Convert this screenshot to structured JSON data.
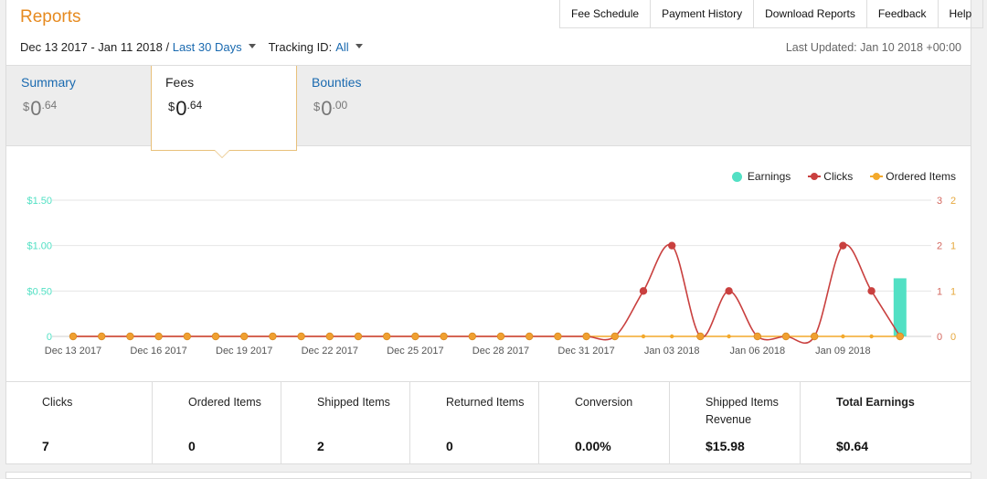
{
  "header": {
    "title": "Reports"
  },
  "nav_links": [
    "Fee Schedule",
    "Payment History",
    "Download Reports",
    "Feedback",
    "Help"
  ],
  "filters": {
    "date_range": "Dec 13 2017 - Jan 11 2018",
    "separator": " / ",
    "preset": "Last 30 Days",
    "tracking_label": "Tracking ID:",
    "tracking_value": "All"
  },
  "last_updated": "Last Updated: Jan 10 2018 +00:00",
  "tabs": [
    {
      "name": "Summary",
      "currency": "$",
      "whole": "0",
      "cents": ".64",
      "active": false
    },
    {
      "name": "Fees",
      "currency": "$",
      "whole": "0",
      "cents": ".64",
      "active": true
    },
    {
      "name": "Bounties",
      "currency": "$",
      "whole": "0",
      "cents": ".00",
      "active": false
    }
  ],
  "legend": {
    "earnings": "Earnings",
    "clicks": "Clicks",
    "ordered": "Ordered Items"
  },
  "colors": {
    "accent": "#e68a1f",
    "link": "#1a6ab0",
    "earnings": "#52e0c4",
    "clicks": "#c9403f",
    "ordered": "#f3a92b",
    "clicks_axis": "#d4685f",
    "ordered_axis": "#e6a83e"
  },
  "chart_data": {
    "type": "line",
    "x_ticks": [
      "Dec 13 2017",
      "Dec 16 2017",
      "Dec 19 2017",
      "Dec 22 2017",
      "Dec 25 2017",
      "Dec 28 2017",
      "Dec 31 2017",
      "Jan 03 2018",
      "Jan 06 2018",
      "Jan 09 2018"
    ],
    "left_axis": {
      "ticks": [
        "0",
        "$0.50",
        "$1.00",
        "$1.50"
      ],
      "range": [
        0,
        1.5
      ]
    },
    "right_axis_clicks": {
      "ticks": [
        "0",
        "1",
        "2",
        "3"
      ],
      "range": [
        0,
        3
      ]
    },
    "right_axis_ordered": {
      "ticks": [
        "0",
        "1",
        "1",
        "2"
      ],
      "range": [
        0,
        2
      ]
    },
    "categories": [
      "Dec 13",
      "Dec 14",
      "Dec 15",
      "Dec 16",
      "Dec 17",
      "Dec 18",
      "Dec 19",
      "Dec 20",
      "Dec 21",
      "Dec 22",
      "Dec 23",
      "Dec 24",
      "Dec 25",
      "Dec 26",
      "Dec 27",
      "Dec 28",
      "Dec 29",
      "Dec 30",
      "Dec 31",
      "Jan 01",
      "Jan 02",
      "Jan 03",
      "Jan 04",
      "Jan 05",
      "Jan 06",
      "Jan 07",
      "Jan 08",
      "Jan 09",
      "Jan 10",
      "Jan 11"
    ],
    "series": [
      {
        "name": "Earnings",
        "type": "bar",
        "values": [
          0,
          0,
          0,
          0,
          0,
          0,
          0,
          0,
          0,
          0,
          0,
          0,
          0,
          0,
          0,
          0,
          0,
          0,
          0,
          0,
          0,
          0,
          0,
          0,
          0,
          0,
          0,
          0,
          0,
          0.64
        ]
      },
      {
        "name": "Clicks",
        "type": "line",
        "values": [
          0,
          0,
          0,
          0,
          0,
          0,
          0,
          0,
          0,
          0,
          0,
          0,
          0,
          0,
          0,
          0,
          0,
          0,
          0,
          0,
          1,
          2,
          0,
          1,
          0,
          0,
          0,
          2,
          1,
          0
        ]
      },
      {
        "name": "Ordered Items",
        "type": "line",
        "values": [
          0,
          0,
          0,
          0,
          0,
          0,
          0,
          0,
          0,
          0,
          0,
          0,
          0,
          0,
          0,
          0,
          0,
          0,
          0,
          0,
          0,
          0,
          0,
          0,
          0,
          0,
          0,
          0,
          0,
          0
        ]
      }
    ]
  },
  "stats": [
    {
      "label": "Clicks",
      "value": "7",
      "bold": false
    },
    {
      "label": "Ordered Items",
      "value": "0",
      "bold": false
    },
    {
      "label": "Shipped Items",
      "value": "2",
      "bold": false
    },
    {
      "label": "Returned Items",
      "value": "0",
      "bold": false
    },
    {
      "label": "Conversion",
      "value": "0.00%",
      "bold": false
    },
    {
      "label": "Shipped Items\nRevenue",
      "value": "$15.98",
      "bold": false
    },
    {
      "label": "Total Earnings",
      "value": "$0.64",
      "bold": true
    }
  ]
}
